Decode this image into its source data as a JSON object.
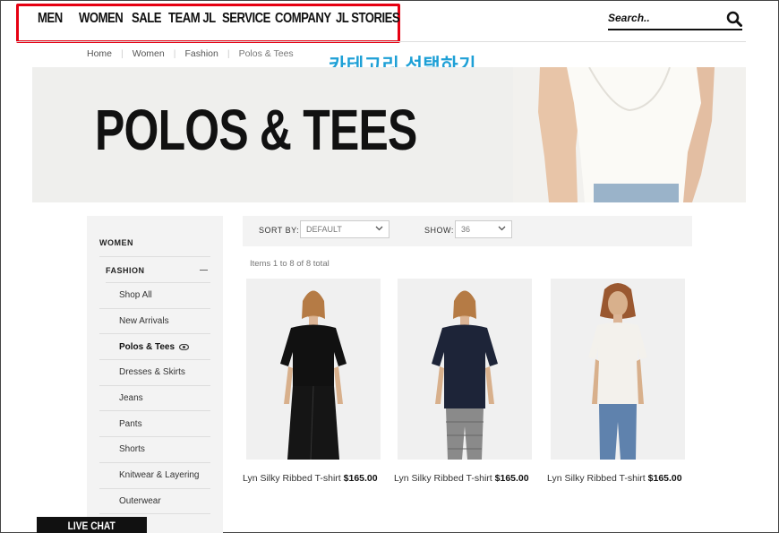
{
  "nav": {
    "items": [
      "MEN",
      "WOMEN",
      "SALE",
      "TEAM JL",
      "SERVICE",
      "COMPANY",
      "JL STORIES"
    ]
  },
  "search": {
    "placeholder": "Search..",
    "icon": "search-icon"
  },
  "breadcrumb": [
    "Home",
    "Women",
    "Fashion",
    "Polos & Tees"
  ],
  "annotation": "카테고리 선택하기",
  "banner": {
    "title": "POLOS & TEES"
  },
  "sidebar": {
    "heading": "WOMEN",
    "sub": "FASHION",
    "items": [
      {
        "label": "Shop All"
      },
      {
        "label": "New Arrivals"
      },
      {
        "label": "Polos & Tees",
        "active": true
      },
      {
        "label": "Dresses & Skirts"
      },
      {
        "label": "Jeans"
      },
      {
        "label": "Pants"
      },
      {
        "label": "Shorts"
      },
      {
        "label": "Knitwear & Layering"
      },
      {
        "label": "Outerwear"
      }
    ]
  },
  "toolbar": {
    "sort_label": "SORT BY:",
    "sort_value": "DEFAULT",
    "show_label": "SHOW:",
    "show_value": "36"
  },
  "count_text": "Items 1 to 8 of 8 total",
  "products": [
    {
      "name": "Lyn Silky Ribbed T-shirt",
      "price": "$165.00",
      "top_color": "#111111",
      "bottom": "skirt"
    },
    {
      "name": "Lyn Silky Ribbed T-shirt",
      "price": "$165.00",
      "top_color": "#1d2438",
      "bottom": "check"
    },
    {
      "name": "Lyn Silky Ribbed T-shirt",
      "price": "$165.00",
      "top_color": "#f3f1ec",
      "bottom": "jeans"
    }
  ],
  "live_chat": "LIVE CHAT",
  "colors": {
    "highlight": "#e60012",
    "annotation": "#1ea0d6"
  }
}
